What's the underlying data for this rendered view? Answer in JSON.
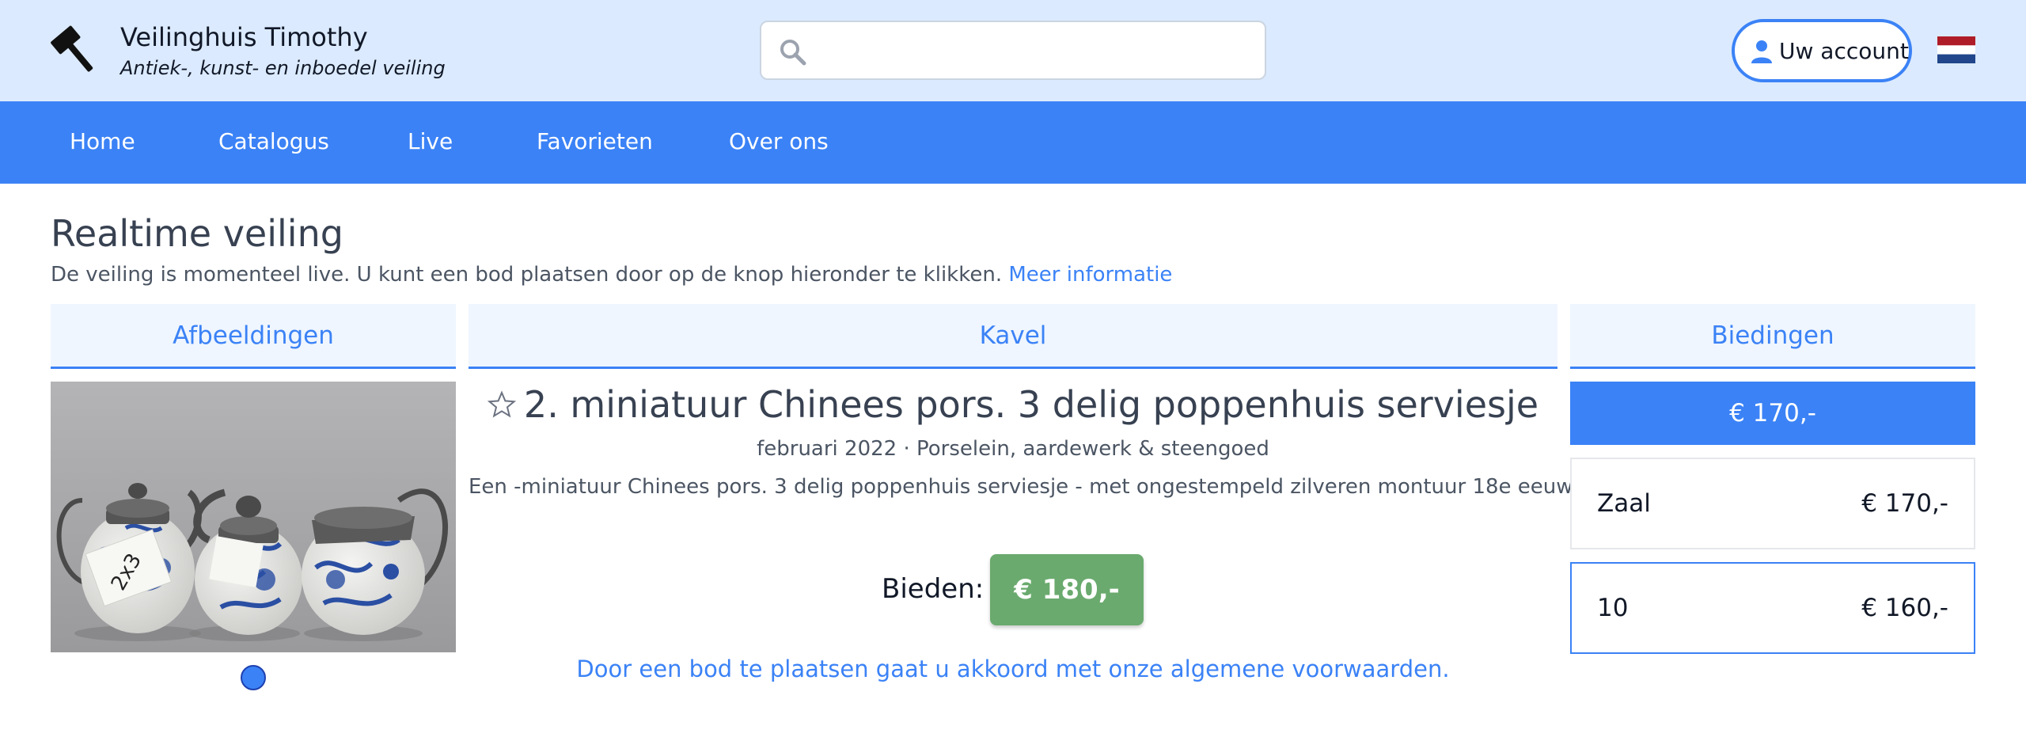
{
  "header": {
    "title": "Veilinghuis Timothy",
    "subtitle": "Antiek-, kunst- en inboedel veiling",
    "search": {
      "value": "",
      "placeholder": ""
    },
    "account_label": "Uw account",
    "icons": {
      "logo": "gavel-icon",
      "search": "search-icon",
      "account": "person-icon",
      "flag": "netherlands-flag-icon"
    }
  },
  "nav": {
    "items": [
      {
        "label": "Home"
      },
      {
        "label": "Catalogus"
      },
      {
        "label": "Live"
      },
      {
        "label": "Favorieten"
      },
      {
        "label": "Over ons"
      }
    ]
  },
  "page": {
    "title": "Realtime veiling",
    "intro": "De veiling is momenteel live. U kunt een bod plaatsen door op de knop hieronder te klikken.",
    "intro_link": "Meer informatie"
  },
  "tabs": {
    "images": "Afbeeldingen",
    "lot": "Kavel",
    "bids": "Biedingen"
  },
  "lot": {
    "title": "2. miniatuur Chinees pors. 3 delig poppenhuis serviesje",
    "meta": "februari 2022 · Porselein, aardewerk & steengoed",
    "description": "Een -miniatuur Chinees pors. 3 delig poppenhuis serviesje - met ongestempeld zilveren montuur 18e eeuw",
    "bid_label": "Bieden:",
    "bid_button": "€ 180,-",
    "terms": "Door een bod te plaatsen gaat u akkoord met onze algemene voorwaarden.",
    "image_label": "2x3"
  },
  "bids": {
    "current": "€ 170,-",
    "rows": [
      {
        "bidder": "Zaal",
        "amount": "€ 170,-"
      },
      {
        "bidder": "10",
        "amount": "€ 160,-"
      }
    ]
  },
  "colors": {
    "header_bg": "#dbeafe",
    "primary": "#3b82f6",
    "bid_button": "#6aaa6e",
    "tab_bg": "#eff6ff"
  }
}
